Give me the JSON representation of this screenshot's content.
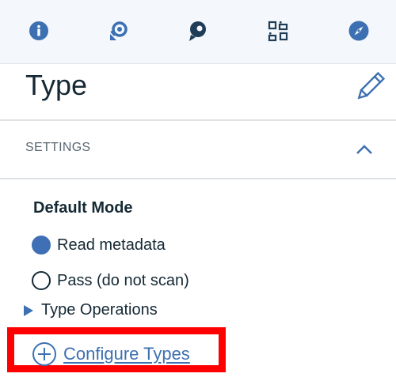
{
  "toolbar": {
    "icons": [
      "info-icon",
      "refresh-icon",
      "comment-icon",
      "qr-grid-icon",
      "compass-icon"
    ]
  },
  "header": {
    "title": "Type"
  },
  "settings": {
    "label": "SETTINGS",
    "expanded": true
  },
  "default_mode": {
    "heading": "Default Mode",
    "options": [
      {
        "label": "Read metadata",
        "selected": true
      },
      {
        "label": "Pass (do not scan)",
        "selected": false
      }
    ]
  },
  "type_operations": {
    "label": "Type Operations",
    "expanded": false
  },
  "configure_types": {
    "label": "Configure Types"
  },
  "colors": {
    "accent": "#3d70b2",
    "radio_selected": "#3f6fb5",
    "highlight": "#ff0000"
  }
}
